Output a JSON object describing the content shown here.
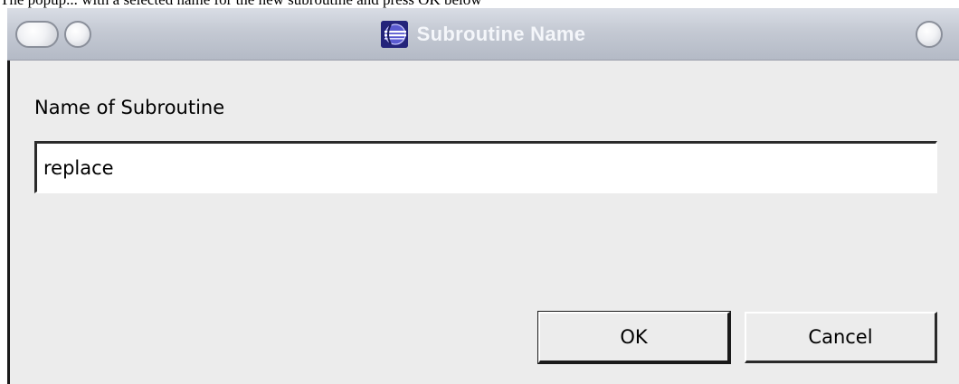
{
  "page": {
    "caption_text": "The popup... with a selected name for the new subroutine and press OK below"
  },
  "window": {
    "title": "Subroutine Name",
    "app_icon": "eclipse-globe-icon",
    "titlebar_buttons": [
      "shade-button",
      "minimize-button",
      "close-button"
    ]
  },
  "form": {
    "label": "Name of Subroutine",
    "input_value": "replace"
  },
  "buttons": {
    "ok": "OK",
    "cancel": "Cancel"
  },
  "colors": {
    "titlebar": "#c4c9d3",
    "title_text": "#f4f6fa",
    "dialog_background": "#ececec",
    "input_background": "#ffffff"
  }
}
